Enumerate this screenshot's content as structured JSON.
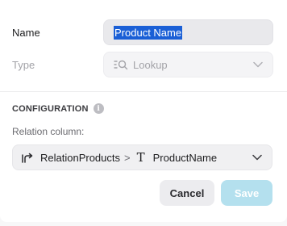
{
  "fields": {
    "name": {
      "label": "Name",
      "value": "Product Name"
    },
    "type": {
      "label": "Type",
      "value": "Lookup",
      "icon": "lookup-icon"
    }
  },
  "configuration": {
    "title": "CONFIGURATION",
    "info_icon": "i",
    "relation_label": "Relation column:",
    "relation_column": "RelationProducts",
    "separator": ">",
    "target_type_icon": "T",
    "target_column": "ProductName"
  },
  "actions": {
    "cancel_label": "Cancel",
    "save_label": "Save"
  },
  "colors": {
    "selection": "#1a5fd6",
    "save_disabled": "#b4e0ee"
  }
}
